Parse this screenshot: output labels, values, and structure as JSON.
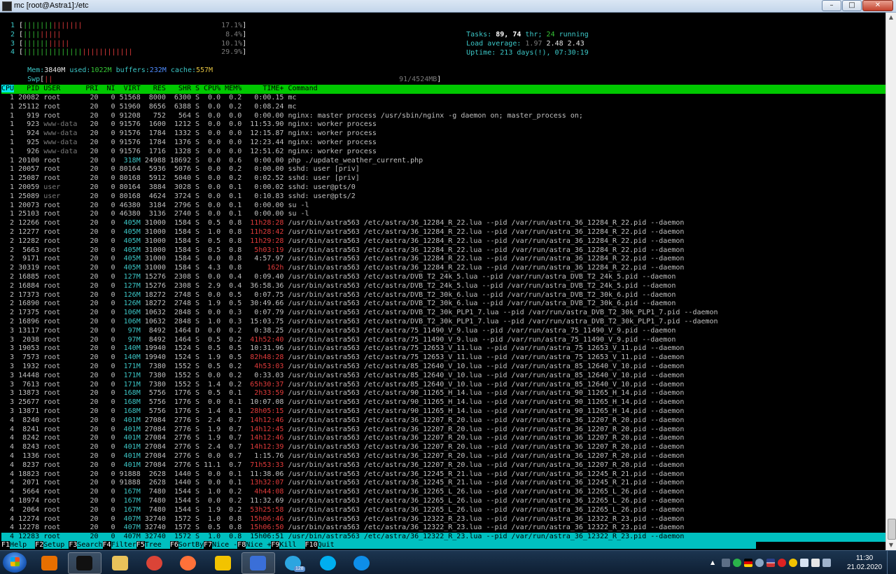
{
  "window": {
    "title": "mc [root@Astra1]:/etc",
    "buttons": {
      "minimize": "–",
      "maximize": "□",
      "close": "✕"
    }
  },
  "meters": {
    "cpus": [
      {
        "n": "1",
        "bars": "||||||||||||||",
        "pct": "17.1%"
      },
      {
        "n": "2",
        "bars": "|||||||||",
        "pct": "8.4%"
      },
      {
        "n": "3",
        "bars": "|||||||||||",
        "pct": "10.1%"
      },
      {
        "n": "4",
        "bars": "||||||||||||||||||||||||||",
        "pct": "29.9%"
      }
    ],
    "mem": {
      "label": "Mem:",
      "total": "3840M",
      "used_label": "used:",
      "used": "1022M",
      "buffers_label": "buffers:",
      "buffers": "232M",
      "cache_label": "cache:",
      "cache": "557M"
    },
    "swp": {
      "label": "Swp",
      "bars": "||",
      "value": "91/4524MB"
    }
  },
  "stats": {
    "tasks_label": "Tasks:",
    "tasks": "89,",
    "thr": "74",
    "thr_label": "thr;",
    "running": "24",
    "running_label": "running",
    "load_label": "Load average:",
    "load1": "1.97",
    "load5": "2.48",
    "load15": "2.43",
    "uptime_label": "Uptime:",
    "uptime": "213 days(!), 07:30:19"
  },
  "header": {
    "cpu": "CPU",
    "pid": "PID",
    "user": "USER",
    "pri": "PRI",
    "ni": "NI",
    "virt": "VIRT",
    "res": "RES",
    "shr": "SHR",
    "s": "S",
    "cpu_pct": "CPU%",
    "mem_pct": "MEM%",
    "time": "TIME+",
    "command": "Command"
  },
  "processes": [
    [
      "1",
      "20082",
      "root",
      "20",
      "0",
      "51568",
      "8000",
      "6300",
      "S",
      "0.0",
      "0.2",
      "0:00.15",
      "mc"
    ],
    [
      "1",
      "25112",
      "root",
      "20",
      "0",
      "51960",
      "8656",
      "6388",
      "S",
      "0.0",
      "0.2",
      "0:08.24",
      "mc"
    ],
    [
      "1",
      "919",
      "root",
      "20",
      "0",
      "91208",
      "752",
      "564",
      "S",
      "0.0",
      "0.0",
      "0:00.00",
      "nginx: master process /usr/sbin/nginx -g daemon on; master_process on;"
    ],
    [
      "1",
      "923",
      "www-data",
      "20",
      "0",
      "91576",
      "1600",
      "1212",
      "S",
      "0.0",
      "0.0",
      "11:53.90",
      "nginx: worker process"
    ],
    [
      "1",
      "924",
      "www-data",
      "20",
      "0",
      "91576",
      "1784",
      "1332",
      "S",
      "0.0",
      "0.0",
      "12:15.87",
      "nginx: worker process"
    ],
    [
      "1",
      "925",
      "www-data",
      "20",
      "0",
      "91576",
      "1784",
      "1376",
      "S",
      "0.0",
      "0.0",
      "12:23.44",
      "nginx: worker process"
    ],
    [
      "1",
      "926",
      "www-data",
      "20",
      "0",
      "91576",
      "1716",
      "1328",
      "S",
      "0.0",
      "0.0",
      "12:51.62",
      "nginx: worker process"
    ],
    [
      "1",
      "20100",
      "root",
      "20",
      "0",
      "318M",
      "24988",
      "18692",
      "S",
      "0.0",
      "0.6",
      "0:00.00",
      "php ./update_weather_current.php"
    ],
    [
      "1",
      "20057",
      "root",
      "20",
      "0",
      "80164",
      "5936",
      "5076",
      "S",
      "0.0",
      "0.2",
      "0:00.00",
      "sshd: user [priv]"
    ],
    [
      "1",
      "25087",
      "root",
      "20",
      "0",
      "80168",
      "5912",
      "5040",
      "S",
      "0.0",
      "0.2",
      "0:02.52",
      "sshd: user [priv]"
    ],
    [
      "1",
      "20059",
      "user",
      "20",
      "0",
      "80164",
      "3884",
      "3028",
      "S",
      "0.0",
      "0.1",
      "0:00.02",
      "sshd: user@pts/0"
    ],
    [
      "1",
      "25089",
      "user",
      "20",
      "0",
      "80168",
      "4624",
      "3724",
      "S",
      "0.0",
      "0.1",
      "0:10.83",
      "sshd: user@pts/2"
    ],
    [
      "1",
      "20073",
      "root",
      "20",
      "0",
      "46380",
      "3184",
      "2796",
      "S",
      "0.0",
      "0.1",
      "0:00.00",
      "su -l"
    ],
    [
      "1",
      "25103",
      "root",
      "20",
      "0",
      "46380",
      "3136",
      "2740",
      "S",
      "0.0",
      "0.1",
      "0:00.00",
      "su -l"
    ],
    [
      "2",
      "12266",
      "root",
      "20",
      "0",
      "405M",
      "31000",
      "1584",
      "S",
      "0.5",
      "0.8",
      "11h28:28",
      "/usr/bin/astra563 /etc/astra/36_12284_R_22.lua --pid /var/run/astra_36_12284_R_22.pid --daemon"
    ],
    [
      "2",
      "12277",
      "root",
      "20",
      "0",
      "405M",
      "31000",
      "1584",
      "S",
      "1.0",
      "0.8",
      "11h28:42",
      "/usr/bin/astra563 /etc/astra/36_12284_R_22.lua --pid /var/run/astra_36_12284_R_22.pid --daemon"
    ],
    [
      "2",
      "12282",
      "root",
      "20",
      "0",
      "405M",
      "31000",
      "1584",
      "S",
      "0.5",
      "0.8",
      "11h29:28",
      "/usr/bin/astra563 /etc/astra/36_12284_R_22.lua --pid /var/run/astra_36_12284_R_22.pid --daemon"
    ],
    [
      "2",
      "5663",
      "root",
      "20",
      "0",
      "405M",
      "31000",
      "1584",
      "S",
      "0.5",
      "0.8",
      "5h03:19",
      "/usr/bin/astra563 /etc/astra/36_12284_R_22.lua --pid /var/run/astra_36_12284_R_22.pid --daemon"
    ],
    [
      "2",
      "9171",
      "root",
      "20",
      "0",
      "405M",
      "31000",
      "1584",
      "S",
      "0.0",
      "0.8",
      "4:57.97",
      "/usr/bin/astra563 /etc/astra/36_12284_R_22.lua --pid /var/run/astra_36_12284_R_22.pid --daemon"
    ],
    [
      "2",
      "30319",
      "root",
      "20",
      "0",
      "405M",
      "31000",
      "1584",
      "S",
      "4.3",
      "0.8",
      "162h",
      "/usr/bin/astra563 /etc/astra/36_12284_R_22.lua --pid /var/run/astra_36_12284_R_22.pid --daemon"
    ],
    [
      "2",
      "16885",
      "root",
      "20",
      "0",
      "127M",
      "15276",
      "2308",
      "S",
      "0.0",
      "0.4",
      "0:09.40",
      "/usr/bin/astra563 /etc/astra/DVB_T2_24k_5.lua --pid /var/run/astra_DVB_T2_24k_5.pid --daemon"
    ],
    [
      "2",
      "16884",
      "root",
      "20",
      "0",
      "127M",
      "15276",
      "2308",
      "S",
      "2.9",
      "0.4",
      "36:58.36",
      "/usr/bin/astra563 /etc/astra/DVB_T2_24k_5.lua --pid /var/run/astra_DVB_T2_24k_5.pid --daemon"
    ],
    [
      "2",
      "17373",
      "root",
      "20",
      "0",
      "126M",
      "18272",
      "2748",
      "S",
      "0.0",
      "0.5",
      "0:07.75",
      "/usr/bin/astra563 /etc/astra/DVB_T2_30k_6.lua --pid /var/run/astra_DVB_T2_30k_6.pid --daemon"
    ],
    [
      "2",
      "16890",
      "root",
      "20",
      "0",
      "126M",
      "18272",
      "2748",
      "S",
      "1.9",
      "0.5",
      "30:49.66",
      "/usr/bin/astra563 /etc/astra/DVB_T2_30k_6.lua --pid /var/run/astra_DVB_T2_30k_6.pid --daemon"
    ],
    [
      "2",
      "17375",
      "root",
      "20",
      "0",
      "106M",
      "10632",
      "2848",
      "S",
      "0.0",
      "0.3",
      "0:07.79",
      "/usr/bin/astra563 /etc/astra/DVB_T2_30k_PLP1_7.lua --pid /var/run/astra_DVB_T2_30k_PLP1_7.pid --daemon"
    ],
    [
      "2",
      "16896",
      "root",
      "20",
      "0",
      "106M",
      "10632",
      "2848",
      "S",
      "1.0",
      "0.3",
      "15:03.75",
      "/usr/bin/astra563 /etc/astra/DVB_T2_30k_PLP1_7.lua --pid /var/run/astra_DVB_T2_30k_PLP1_7.pid --daemon"
    ],
    [
      "3",
      "13117",
      "root",
      "20",
      "0",
      "97M",
      "8492",
      "1464",
      "D",
      "0.0",
      "0.2",
      "0:38.25",
      "/usr/bin/astra563 /etc/astra/75_11490_V_9.lua --pid /var/run/astra_75_11490_V_9.pid --daemon"
    ],
    [
      "3",
      "2038",
      "root",
      "20",
      "0",
      "97M",
      "8492",
      "1464",
      "S",
      "0.5",
      "0.2",
      "41h52:40",
      "/usr/bin/astra563 /etc/astra/75_11490_V_9.lua --pid /var/run/astra_75_11490_V_9.pid --daemon"
    ],
    [
      "3",
      "19053",
      "root",
      "20",
      "0",
      "140M",
      "19940",
      "1524",
      "S",
      "0.5",
      "0.5",
      "10:31.96",
      "/usr/bin/astra563 /etc/astra/75_12653_V_11.lua --pid /var/run/astra_75_12653_V_11.pid --daemon"
    ],
    [
      "3",
      "7573",
      "root",
      "20",
      "0",
      "140M",
      "19940",
      "1524",
      "S",
      "1.9",
      "0.5",
      "82h48:28",
      "/usr/bin/astra563 /etc/astra/75_12653_V_11.lua --pid /var/run/astra_75_12653_V_11.pid --daemon"
    ],
    [
      "3",
      "1932",
      "root",
      "20",
      "0",
      "171M",
      "7380",
      "1552",
      "S",
      "0.5",
      "0.2",
      "4h53:03",
      "/usr/bin/astra563 /etc/astra/85_12640_V_10.lua --pid /var/run/astra_85_12640_V_10.pid --daemon"
    ],
    [
      "3",
      "14448",
      "root",
      "20",
      "0",
      "171M",
      "7380",
      "1552",
      "S",
      "0.0",
      "0.2",
      "0:33.03",
      "/usr/bin/astra563 /etc/astra/85_12640_V_10.lua --pid /var/run/astra_85_12640_V_10.pid --daemon"
    ],
    [
      "3",
      "7613",
      "root",
      "20",
      "0",
      "171M",
      "7380",
      "1552",
      "S",
      "1.4",
      "0.2",
      "65h30:37",
      "/usr/bin/astra563 /etc/astra/85_12640_V_10.lua --pid /var/run/astra_85_12640_V_10.pid --daemon"
    ],
    [
      "3",
      "13873",
      "root",
      "20",
      "0",
      "168M",
      "5756",
      "1776",
      "S",
      "0.5",
      "0.1",
      "2h33:59",
      "/usr/bin/astra563 /etc/astra/90_11265_H_14.lua --pid /var/run/astra_90_11265_H_14.pid --daemon"
    ],
    [
      "3",
      "25677",
      "root",
      "20",
      "0",
      "168M",
      "5756",
      "1776",
      "S",
      "0.0",
      "0.1",
      "10:07.08",
      "/usr/bin/astra563 /etc/astra/90_11265_H_14.lua --pid /var/run/astra_90_11265_H_14.pid --daemon"
    ],
    [
      "3",
      "13871",
      "root",
      "20",
      "0",
      "168M",
      "5756",
      "1776",
      "S",
      "1.4",
      "0.1",
      "28h05:15",
      "/usr/bin/astra563 /etc/astra/90_11265_H_14.lua --pid /var/run/astra_90_11265_H_14.pid --daemon"
    ],
    [
      "4",
      "8240",
      "root",
      "20",
      "0",
      "401M",
      "27084",
      "2776",
      "S",
      "2.4",
      "0.7",
      "14h12:46",
      "/usr/bin/astra563 /etc/astra/36_12207_R_20.lua --pid /var/run/astra_36_12207_R_20.pid --daemon"
    ],
    [
      "4",
      "8241",
      "root",
      "20",
      "0",
      "401M",
      "27084",
      "2776",
      "S",
      "1.9",
      "0.7",
      "14h12:45",
      "/usr/bin/astra563 /etc/astra/36_12207_R_20.lua --pid /var/run/astra_36_12207_R_20.pid --daemon"
    ],
    [
      "4",
      "8242",
      "root",
      "20",
      "0",
      "401M",
      "27084",
      "2776",
      "S",
      "1.9",
      "0.7",
      "14h12:46",
      "/usr/bin/astra563 /etc/astra/36_12207_R_20.lua --pid /var/run/astra_36_12207_R_20.pid --daemon"
    ],
    [
      "4",
      "8243",
      "root",
      "20",
      "0",
      "401M",
      "27084",
      "2776",
      "S",
      "2.4",
      "0.7",
      "14h12:39",
      "/usr/bin/astra563 /etc/astra/36_12207_R_20.lua --pid /var/run/astra_36_12207_R_20.pid --daemon"
    ],
    [
      "4",
      "1336",
      "root",
      "20",
      "0",
      "401M",
      "27084",
      "2776",
      "S",
      "0.0",
      "0.7",
      "1:15.76",
      "/usr/bin/astra563 /etc/astra/36_12207_R_20.lua --pid /var/run/astra_36_12207_R_20.pid --daemon"
    ],
    [
      "4",
      "8237",
      "root",
      "20",
      "0",
      "401M",
      "27084",
      "2776",
      "S",
      "11.1",
      "0.7",
      "71h53:33",
      "/usr/bin/astra563 /etc/astra/36_12207_R_20.lua --pid /var/run/astra_36_12207_R_20.pid --daemon"
    ],
    [
      "4",
      "18823",
      "root",
      "20",
      "0",
      "91888",
      "2628",
      "1440",
      "S",
      "0.0",
      "0.1",
      "11:38.06",
      "/usr/bin/astra563 /etc/astra/36_12245_R_21.lua --pid /var/run/astra_36_12245_R_21.pid --daemon"
    ],
    [
      "4",
      "2071",
      "root",
      "20",
      "0",
      "91888",
      "2628",
      "1440",
      "S",
      "0.0",
      "0.1",
      "13h32:07",
      "/usr/bin/astra563 /etc/astra/36_12245_R_21.lua --pid /var/run/astra_36_12245_R_21.pid --daemon"
    ],
    [
      "4",
      "5664",
      "root",
      "20",
      "0",
      "167M",
      "7480",
      "1544",
      "S",
      "1.0",
      "0.2",
      "4h44:08",
      "/usr/bin/astra563 /etc/astra/36_12265_L_26.lua --pid /var/run/astra_36_12265_L_26.pid --daemon"
    ],
    [
      "4",
      "18974",
      "root",
      "20",
      "0",
      "167M",
      "7480",
      "1544",
      "S",
      "0.0",
      "0.2",
      "11:32.69",
      "/usr/bin/astra563 /etc/astra/36_12265_L_26.lua --pid /var/run/astra_36_12265_L_26.pid --daemon"
    ],
    [
      "4",
      "2064",
      "root",
      "20",
      "0",
      "167M",
      "7480",
      "1544",
      "S",
      "1.9",
      "0.2",
      "53h25:58",
      "/usr/bin/astra563 /etc/astra/36_12265_L_26.lua --pid /var/run/astra_36_12265_L_26.pid --daemon"
    ],
    [
      "4",
      "12274",
      "root",
      "20",
      "0",
      "407M",
      "32740",
      "1572",
      "S",
      "1.0",
      "0.8",
      "15h06:46",
      "/usr/bin/astra563 /etc/astra/36_12322_R_23.lua --pid /var/run/astra_36_12322_R_23.pid --daemon"
    ],
    [
      "4",
      "12278",
      "root",
      "20",
      "0",
      "407M",
      "32740",
      "1572",
      "S",
      "0.5",
      "0.8",
      "15h06:50",
      "/usr/bin/astra563 /etc/astra/36_12322_R_23.lua --pid /var/run/astra_36_12322_R_23.pid --daemon"
    ],
    [
      "4",
      "12283",
      "root",
      "20",
      "0",
      "407M",
      "32740",
      "1572",
      "S",
      "1.0",
      "0.8",
      "15h06:51",
      "/usr/bin/astra563 /etc/astra/36_12322_R_23.lua --pid /var/run/astra_36_12322_R_23.pid --daemon"
    ]
  ],
  "selected_index": 49,
  "fkeys": [
    {
      "key": "F1",
      "label": "Help  "
    },
    {
      "key": "F2",
      "label": "Setup "
    },
    {
      "key": "F3",
      "label": "Search"
    },
    {
      "key": "F4",
      "label": "Filter"
    },
    {
      "key": "F5",
      "label": "Tree  "
    },
    {
      "key": "F6",
      "label": "SortBy"
    },
    {
      "key": "F7",
      "label": "Nice -"
    },
    {
      "key": "F8",
      "label": "Nice +"
    },
    {
      "key": "F9",
      "label": "Kill  "
    },
    {
      "key": "F10",
      "label": "Quit"
    }
  ],
  "taskbar": {
    "apps": [
      {
        "name": "java-icon",
        "color": "#e76f00"
      },
      {
        "name": "terminal-icon",
        "color": "#111111",
        "active": true
      },
      {
        "name": "file-explorer-icon",
        "color": "#e8c25a"
      },
      {
        "name": "chrome-icon",
        "color": "#db4437"
      },
      {
        "name": "firefox-icon",
        "color": "#ff7139"
      },
      {
        "name": "batman-icon",
        "color": "#f2c300"
      },
      {
        "name": "network-app-icon",
        "color": "#3a6fd8",
        "active": true
      },
      {
        "name": "telegram-icon",
        "color": "#2ca5e0",
        "badge": "128"
      },
      {
        "name": "skype-icon",
        "color": "#00aff0"
      },
      {
        "name": "teamviewer-icon",
        "color": "#0e8ee9"
      }
    ],
    "clock_time": "11:30",
    "clock_date": "21.02.2020"
  }
}
